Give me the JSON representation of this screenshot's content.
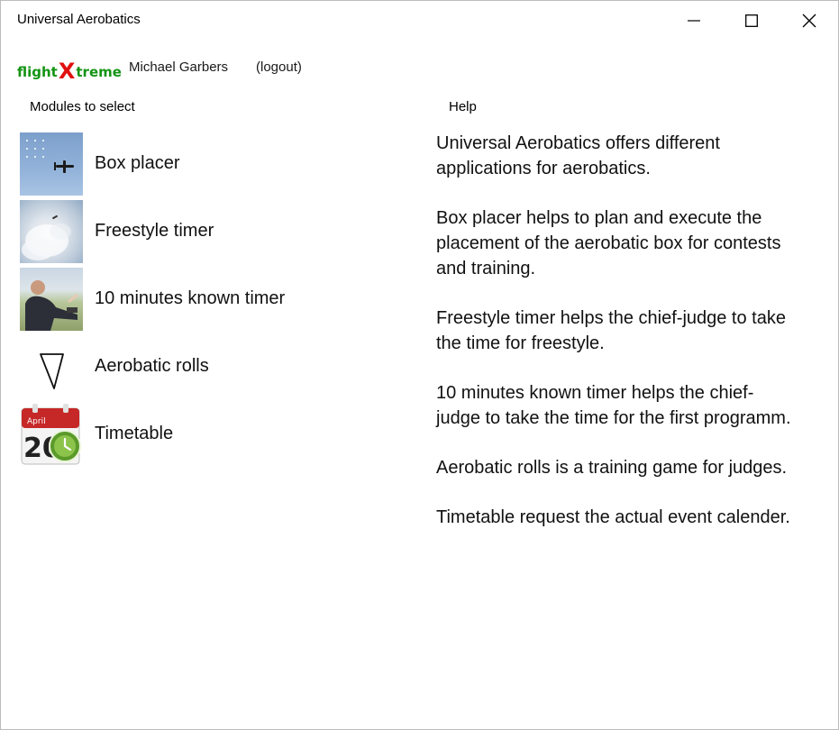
{
  "window": {
    "title": "Universal Aerobatics",
    "controls": {
      "minimize_icon": "minimize-icon",
      "maximize_icon": "maximize-icon",
      "close_icon": "close-icon"
    }
  },
  "header": {
    "logo_prefix": "flight",
    "logo_x": "X",
    "logo_suffix": "treme",
    "user_name": "Michael Garbers",
    "logout_label": "(logout)",
    "colors": {
      "logo_green": "#149414",
      "logo_red": "#e01010"
    }
  },
  "modules": {
    "heading": "Modules to select",
    "items": [
      {
        "label": "Box placer",
        "icon": "aerobatic-plane-photo"
      },
      {
        "label": "Freestyle timer",
        "icon": "smoke-trail-photo"
      },
      {
        "label": "10 minutes known timer",
        "icon": "pilot-photo"
      },
      {
        "label": "Aerobatic rolls",
        "icon": "triangle-icon"
      },
      {
        "label": "Timetable",
        "icon": "calendar-clock-icon",
        "calendar_month": "April",
        "calendar_day": "20"
      }
    ]
  },
  "help": {
    "heading": "Help",
    "paragraphs": [
      "Universal Aerobatics offers different applications for aerobatics.",
      "Box placer helps to plan and execute the placement of the aerobatic box for contests and training.",
      "Freestyle timer helps the chief-judge to take the time for freestyle.",
      "10 minutes known timer helps the chief-judge to take the time for the first programm.",
      "Aerobatic rolls is a training game for judges.",
      "Timetable request the actual event calender."
    ]
  }
}
